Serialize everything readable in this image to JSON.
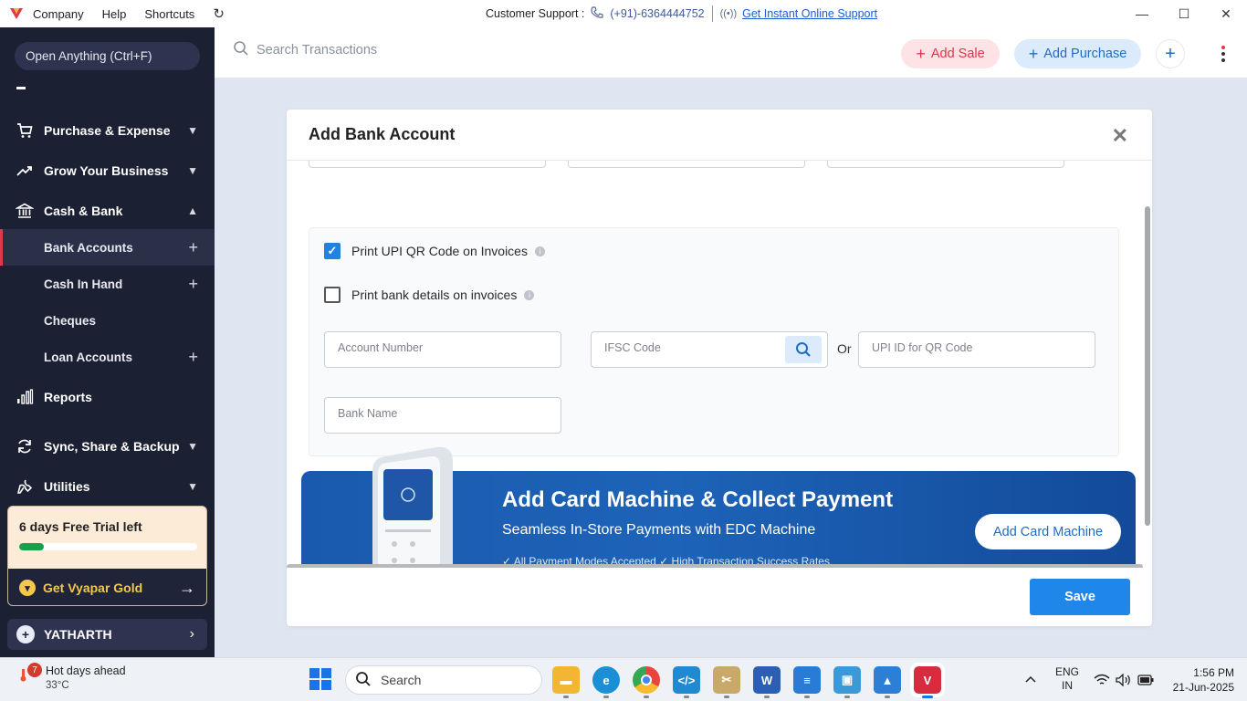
{
  "titlebar": {
    "menu": [
      "Company",
      "Help",
      "Shortcuts"
    ],
    "support_label": "Customer Support :",
    "support_phone": "(+91)-6364444752",
    "support_link": "Get Instant Online Support"
  },
  "sidebar": {
    "open_anything": "Open Anything (Ctrl+F)",
    "items": [
      {
        "label": "Purchase & Expense",
        "icon": "cart-icon"
      },
      {
        "label": "Grow Your Business",
        "icon": "trend-icon"
      },
      {
        "label": "Cash & Bank",
        "icon": "bank-icon"
      },
      {
        "label": "Reports",
        "icon": "reports-icon"
      },
      {
        "label": "Sync, Share & Backup",
        "icon": "sync-icon"
      },
      {
        "label": "Utilities",
        "icon": "utilities-icon"
      }
    ],
    "sub_items": [
      {
        "label": "Bank Accounts"
      },
      {
        "label": "Cash In Hand"
      },
      {
        "label": "Cheques"
      },
      {
        "label": "Loan Accounts"
      }
    ],
    "trial_text": "6 days Free Trial left",
    "trial_progress": 0.14,
    "gold_label": "Get Vyapar Gold",
    "user_name": "YATHARTH"
  },
  "topbar": {
    "search_placeholder": "Search Transactions",
    "add_sale": "Add Sale",
    "add_purchase": "Add Purchase"
  },
  "modal": {
    "title": "Add Bank Account",
    "print_upi_label": "Print UPI QR Code on Invoices",
    "print_upi_checked": true,
    "print_bank_label": "Print bank details on invoices",
    "print_bank_checked": false,
    "account_number_placeholder": "Account Number",
    "ifsc_placeholder": "IFSC Code",
    "or_label": "Or",
    "upi_placeholder": "UPI ID for QR Code",
    "bank_name_placeholder": "Bank Name",
    "banner_title": "Add Card Machine & Collect Payment",
    "banner_subtitle": "Seamless In-Store Payments with EDC Machine",
    "banner_bullets": "✓  All Payment Modes Accepted        ✓  High Transaction Success Rates",
    "banner_cta": "Add Card Machine",
    "save_label": "Save"
  },
  "taskbar": {
    "weather_badge": "7",
    "weather_title": "Hot days ahead",
    "weather_temp": "33°C",
    "search_label": "Search",
    "lang_top": "ENG",
    "lang_bottom": "IN",
    "time": "1:56 PM",
    "date": "21-Jun-2025"
  },
  "colors": {
    "sidebar_bg": "#1b2033",
    "accent_blue": "#1f87ea",
    "accent_red": "#e03548",
    "gold": "#f3c84b",
    "trial_green": "#15a14a"
  }
}
